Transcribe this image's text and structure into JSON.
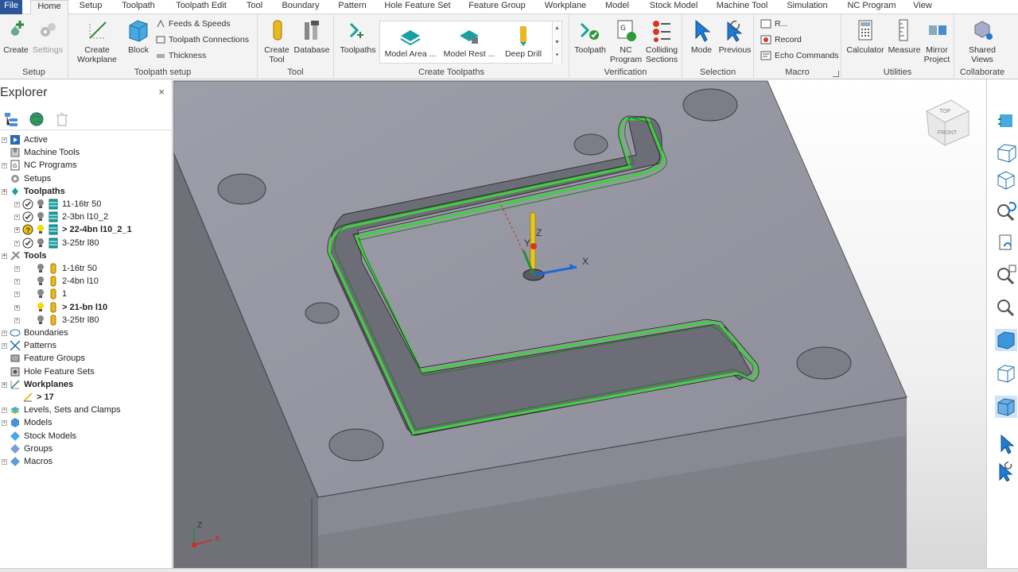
{
  "tabs": [
    "File",
    "Home",
    "Setup",
    "Toolpath",
    "Toolpath Edit",
    "Tool",
    "Boundary",
    "Pattern",
    "Hole Feature Set",
    "Feature Group",
    "Workplane",
    "Model",
    "Stock Model",
    "Machine Tool",
    "Simulation",
    "NC Program",
    "View"
  ],
  "ribbon": {
    "setup": {
      "title": "Setup",
      "create": "Create",
      "settings": "Settings"
    },
    "toolpath_setup": {
      "title": "Toolpath setup",
      "create_workplane": "Create Workplane",
      "block": "Block",
      "feeds": "Feeds & Speeds",
      "connections": "Toolpath Connections",
      "thickness": "Thickness"
    },
    "tool": {
      "title": "Tool",
      "create_tool": "Create Tool",
      "database": "Database"
    },
    "create_toolpaths": {
      "title": "Create Toolpaths",
      "toolpaths": "Toolpaths",
      "gallery": [
        "Model Area ...",
        "Model Rest ...",
        "Deep Drill"
      ]
    },
    "verification": {
      "title": "Verification",
      "toolpath": "Toolpath",
      "nc_program": "NC Program",
      "colliding": "Colliding Sections"
    },
    "selection": {
      "title": "Selection",
      "mode": "Mode",
      "previous": "Previous"
    },
    "macro": {
      "title": "Macro",
      "run": "R...",
      "record": "Record",
      "echo": "Echo Commands"
    },
    "utilities": {
      "title": "Utilities",
      "calculator": "Calculator",
      "measure": "Measure",
      "mirror": "Mirror Project"
    },
    "collaborate": {
      "title": "Collaborate",
      "shared": "Shared Views"
    }
  },
  "explorer": {
    "title": "Explorer",
    "tree": [
      {
        "label": "Active",
        "level": 0,
        "bold": false,
        "icon": "active-icon",
        "expander": true
      },
      {
        "label": "Machine Tools",
        "level": 0,
        "bold": false,
        "icon": "machine-tool-icon",
        "expander": false
      },
      {
        "label": "NC Programs",
        "level": 0,
        "bold": false,
        "icon": "nc-program-icon",
        "expander": true
      },
      {
        "label": "Setups",
        "level": 0,
        "bold": false,
        "icon": "setup-icon",
        "expander": false
      },
      {
        "label": "Toolpaths",
        "level": 0,
        "bold": true,
        "icon": "toolpath-folder-icon",
        "expander": true
      },
      {
        "label": "11-16tr 50",
        "level": 1,
        "bold": false,
        "icon": "toolpath-icon",
        "status": "check",
        "expander": true
      },
      {
        "label": "2-3bn l10_2",
        "level": 1,
        "bold": false,
        "icon": "toolpath-icon",
        "status": "check",
        "expander": true
      },
      {
        "label": "> 22-4bn l10_2_1",
        "level": 1,
        "bold": true,
        "icon": "toolpath-icon",
        "status": "question",
        "expander": true
      },
      {
        "label": "3-25tr l80",
        "level": 1,
        "bold": false,
        "icon": "toolpath-icon",
        "status": "check",
        "expander": true
      },
      {
        "label": "Tools",
        "level": 0,
        "bold": true,
        "icon": "tools-icon",
        "expander": true
      },
      {
        "label": "1-16tr 50",
        "level": 1,
        "bold": false,
        "icon": "tool-icon",
        "expander": true
      },
      {
        "label": "2-4bn l10",
        "level": 1,
        "bold": false,
        "icon": "tool-icon",
        "expander": true
      },
      {
        "label": "1",
        "level": 1,
        "bold": false,
        "icon": "tool-icon",
        "expander": true
      },
      {
        "label": "> 21-bn l10",
        "level": 1,
        "bold": true,
        "icon": "tool-icon",
        "expander": true
      },
      {
        "label": "3-25tr l80",
        "level": 1,
        "bold": false,
        "icon": "tool-icon",
        "expander": true
      },
      {
        "label": "Boundaries",
        "level": 0,
        "bold": false,
        "icon": "boundary-icon",
        "expander": true
      },
      {
        "label": "Patterns",
        "level": 0,
        "bold": false,
        "icon": "pattern-icon",
        "expander": true
      },
      {
        "label": "Feature Groups",
        "level": 0,
        "bold": false,
        "icon": "feature-group-icon",
        "expander": false
      },
      {
        "label": "Hole Feature Sets",
        "level": 0,
        "bold": false,
        "icon": "hole-feature-icon",
        "expander": false
      },
      {
        "label": "Workplanes",
        "level": 0,
        "bold": true,
        "icon": "workplane-icon",
        "expander": true
      },
      {
        "label": "> 17",
        "level": 1,
        "bold": true,
        "icon": "workplane-item-icon",
        "expander": false
      },
      {
        "label": "Levels, Sets and Clamps",
        "level": 0,
        "bold": false,
        "icon": "levels-icon",
        "expander": true
      },
      {
        "label": "Models",
        "level": 0,
        "bold": false,
        "icon": "model-icon",
        "expander": true
      },
      {
        "label": "Stock Models",
        "level": 0,
        "bold": false,
        "icon": "stock-model-icon",
        "expander": false
      },
      {
        "label": "Groups",
        "level": 0,
        "bold": false,
        "icon": "group-icon",
        "expander": false
      },
      {
        "label": "Macros",
        "level": 0,
        "bold": false,
        "icon": "macro-icon",
        "expander": true
      }
    ]
  },
  "viewport": {
    "axis_x": "X",
    "axis_y": "Y",
    "axis_z": "Z",
    "triad_x": "X",
    "triad_z": "Z",
    "viewcube_top": "TOP",
    "viewcube_front": "FRONT"
  },
  "colors": {
    "accent": "#2b579a",
    "toolpath": "#3fd13f",
    "part": "#8e8f99",
    "part_top": "#9a9ba6"
  }
}
